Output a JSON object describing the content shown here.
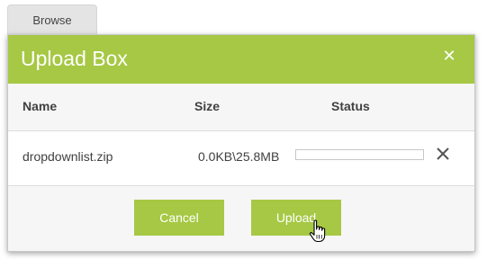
{
  "browse": {
    "label": "Browse"
  },
  "dialog": {
    "title": "Upload Box",
    "columns": {
      "name": "Name",
      "size": "Size",
      "status": "Status"
    },
    "files": [
      {
        "name": "dropdownlist.zip",
        "size": "0.0KB\\25.8MB",
        "progress": 0
      }
    ],
    "buttons": {
      "cancel": "Cancel",
      "upload": "Upload"
    }
  },
  "colors": {
    "accent": "#a6c844",
    "text": "#404040",
    "band": "#f6f6f6"
  },
  "icons": {
    "dialog_close": "close-icon",
    "file_remove": "remove-file-icon",
    "cursor": "hand-pointer-icon"
  }
}
